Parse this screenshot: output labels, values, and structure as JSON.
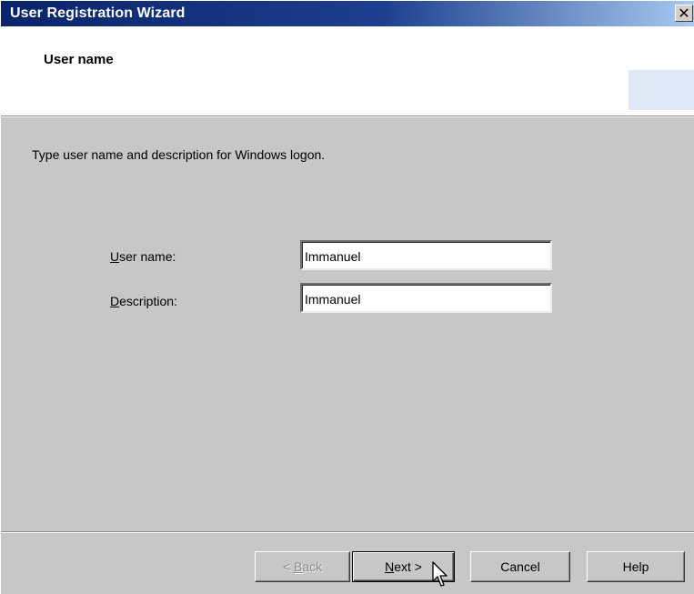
{
  "window": {
    "title": "User Registration Wizard",
    "close_icon": "close-icon",
    "close_glyph": "✕"
  },
  "header": {
    "title": "User name"
  },
  "body": {
    "instruction": "Type user name and description for Windows logon."
  },
  "fields": {
    "user_name": {
      "label_mnemonic": "U",
      "label_rest": "ser name:",
      "value": "Immanuel"
    },
    "description": {
      "label_mnemonic": "D",
      "label_rest": "escription:",
      "value": "Immanuel"
    }
  },
  "buttons": {
    "back": {
      "prefix": "< ",
      "mnemonic": "B",
      "rest": "ack",
      "enabled": false
    },
    "next": {
      "mnemonic": "N",
      "rest": "ext >",
      "default": true
    },
    "cancel": {
      "label": "Cancel"
    },
    "help": {
      "label": "Help"
    }
  },
  "cursor": {
    "icon": "mouse-pointer-icon"
  },
  "colors": {
    "titlebar_start": "#0a246a",
    "titlebar_end": "#a6caf0",
    "dialog_face": "#c7c7c7",
    "header_background": "#ffffff"
  }
}
